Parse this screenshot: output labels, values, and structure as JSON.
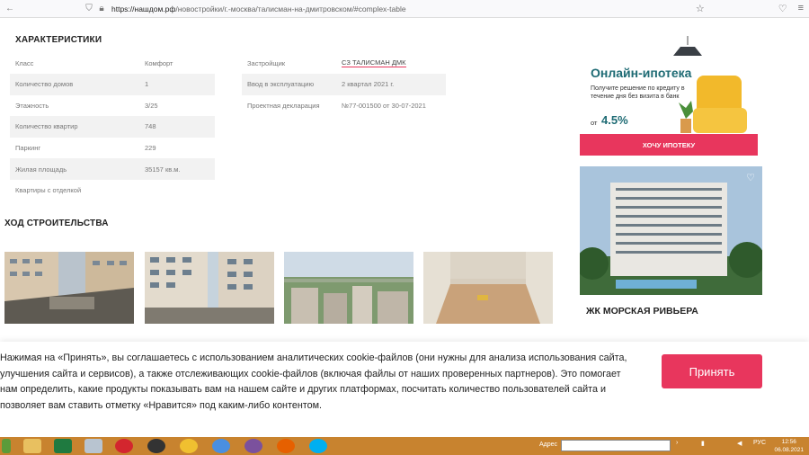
{
  "browser": {
    "url_domain": "https://нашдом.рф",
    "url_path": "/новостройки/г.-москва/талисман-на-дмитровском/#complex-table"
  },
  "specs": {
    "title": "ХАРАКТЕРИСТИКИ",
    "left": [
      {
        "key": "Класс",
        "value": "Комфорт"
      },
      {
        "key": "Количество домов",
        "value": "1"
      },
      {
        "key": "Этажность",
        "value": "3/25"
      },
      {
        "key": "Количество квартир",
        "value": "748"
      },
      {
        "key": "Паркинг",
        "value": "229"
      },
      {
        "key": "Жилая площадь",
        "value": "35157 кв.м."
      },
      {
        "key": "Квартиры с отделкой",
        "value": ""
      }
    ],
    "right": [
      {
        "key": "Застройщик",
        "value": "СЗ ТАЛИСМАН ДМК"
      },
      {
        "key": "Ввод в эксплуатацию",
        "value": "2 квартал 2021 г."
      },
      {
        "key": "Проектная декларация",
        "value": "№77-001500 от 30-07-2021"
      }
    ]
  },
  "progress": {
    "title": "ХОД СТРОИТЕЛЬСТВА"
  },
  "ad": {
    "title": "Онлайн-ипотека",
    "subtitle": "Получите решение по кредиту в течение дня без визита в банк",
    "rate_prefix": "от",
    "rate": "4.5%",
    "button": "ХОЧУ ИПОТЕКУ"
  },
  "listing": {
    "title": "ЖК МОРСКАЯ РИВЬЕРА"
  },
  "cookie": {
    "text": "Нажимая на «Принять», вы соглашаетесь с использованием аналитических cookie-файлов (они нужны для анализа использования сайта, улучшения сайта и сервисов), а также отслеживающих cookie-файлов (включая файлы от наших проверенных партнеров). Это помогает нам определить, какие продукты показывать вам на нашем сайте и других платформах, посчитать количество пользователей сайта и позволяет вам ставить отметку «Нравится» под каким-либо контентом.",
    "accept": "Принять"
  },
  "taskbar": {
    "address_label": "Адрес",
    "lang": "РУС",
    "time": "12:56",
    "date": "06.08.2021"
  }
}
